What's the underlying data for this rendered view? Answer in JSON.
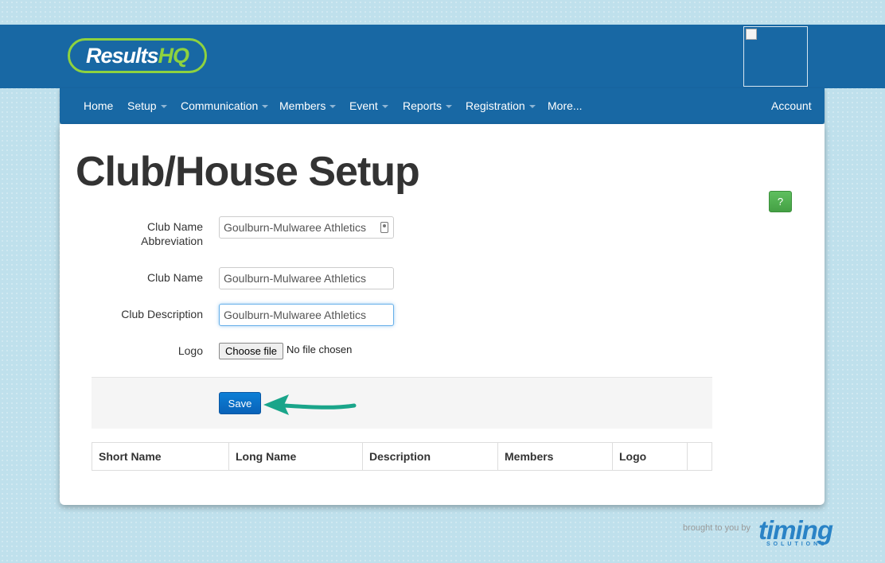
{
  "brand": {
    "logo_part1": "Results",
    "logo_part2": "HQ"
  },
  "nav": {
    "items": [
      {
        "label": "Home",
        "dropdown": false
      },
      {
        "label": "Setup",
        "dropdown": true
      },
      {
        "label": "Communication",
        "dropdown": true
      },
      {
        "label": "Members",
        "dropdown": true
      },
      {
        "label": "Event",
        "dropdown": true
      },
      {
        "label": "Reports",
        "dropdown": true
      },
      {
        "label": "Registration",
        "dropdown": true
      },
      {
        "label": "More...",
        "dropdown": false
      }
    ],
    "account_label": "Account"
  },
  "page": {
    "title": "Club/House Setup",
    "help_label": "?"
  },
  "form": {
    "abbrev_label_line1": "Club Name",
    "abbrev_label_line2": "Abbreviation",
    "abbrev_value": "Goulburn-Mulwaree Athletics",
    "name_label": "Club Name",
    "name_value": "Goulburn-Mulwaree Athletics",
    "desc_label": "Club Description",
    "desc_value": "Goulburn-Mulwaree Athletics",
    "logo_label": "Logo",
    "file_button": "Choose file",
    "file_status": "No file chosen",
    "save_label": "Save"
  },
  "table": {
    "columns": [
      "Short Name",
      "Long Name",
      "Description",
      "Members",
      "Logo",
      ""
    ]
  },
  "footer": {
    "brought_by": "brought to you by",
    "timing_word": "timing",
    "timing_sub": "SOLUTIONS"
  },
  "colors": {
    "header_blue": "#1868a4",
    "logo_green": "#8ed23f",
    "save_blue": "#0a62b8",
    "help_green": "#44a044",
    "arrow_teal": "#1aa58a"
  },
  "icons": {
    "abbrev_field": "contact-card-icon",
    "annotation": "arrow-left-icon"
  }
}
